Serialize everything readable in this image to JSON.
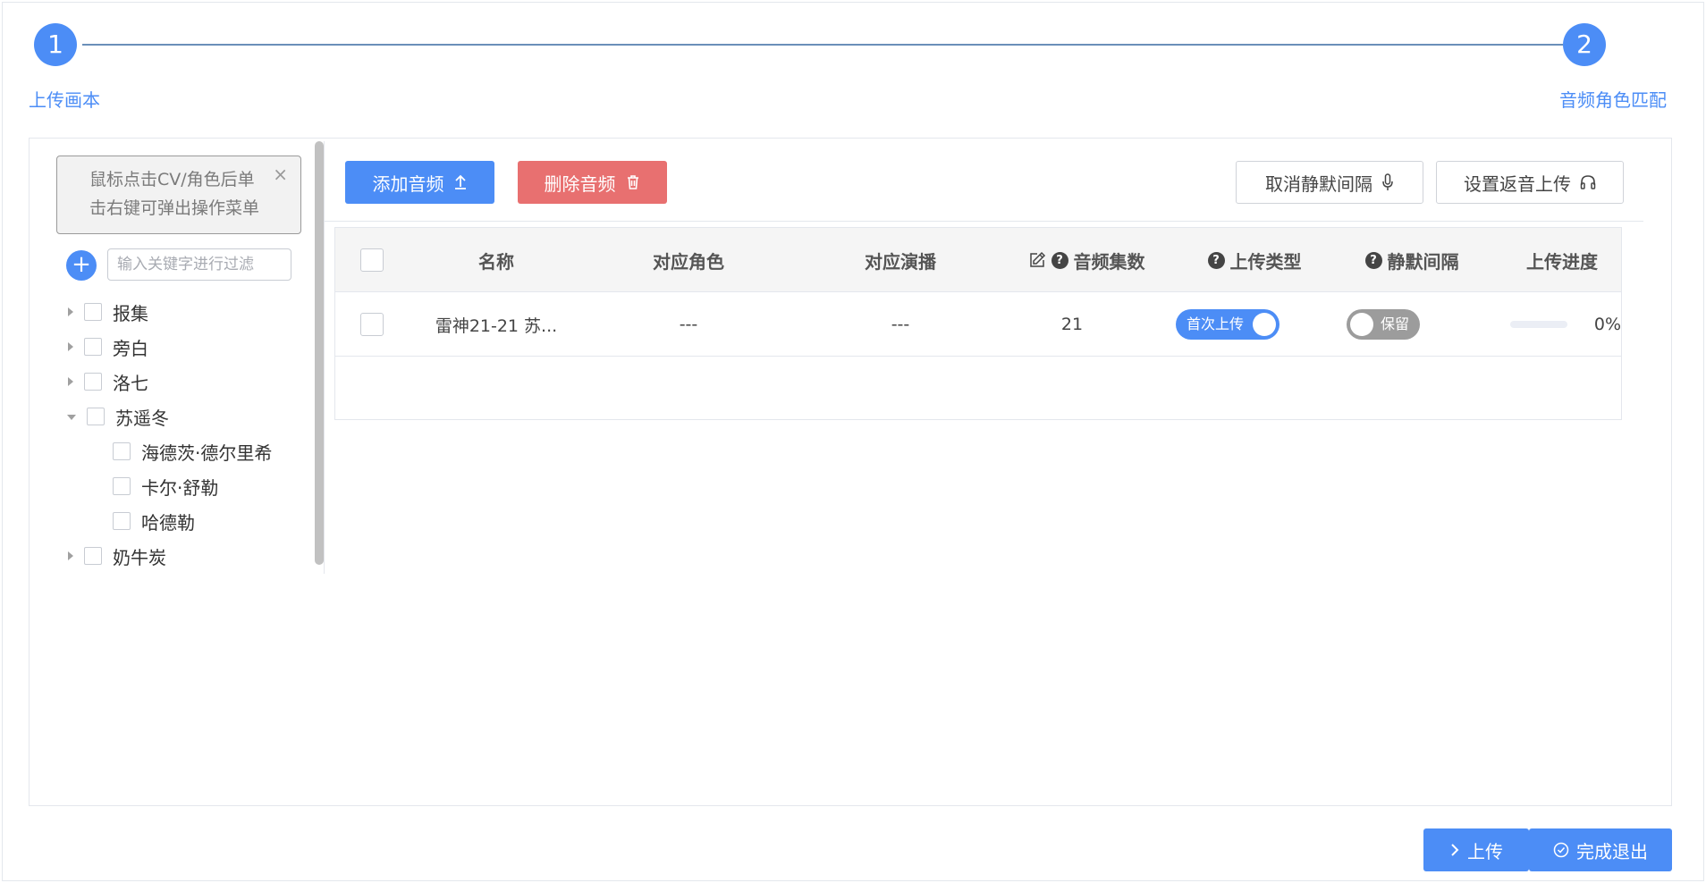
{
  "steps": [
    {
      "number": "1",
      "label": "上传画本"
    },
    {
      "number": "2",
      "label": "音频角色匹配"
    }
  ],
  "tip": {
    "text_line1": "鼠标点击CV/角色后单",
    "text_line2": "击右键可弹出操作菜单",
    "close": "×"
  },
  "filter": {
    "placeholder": "输入关键字进行过滤",
    "value": "",
    "add_symbol": "+"
  },
  "tree": [
    {
      "label": "报集",
      "expanded": false
    },
    {
      "label": "旁白",
      "expanded": false
    },
    {
      "label": "洛七",
      "expanded": false
    },
    {
      "label": "苏遥冬",
      "expanded": true
    },
    {
      "label": "海德茨·德尔里希",
      "child": true
    },
    {
      "label": "卡尔·舒勒",
      "child": true
    },
    {
      "label": "哈德勒",
      "child": true
    },
    {
      "label": "奶牛炭",
      "expanded": false
    }
  ],
  "toolbar": {
    "add_audio": "添加音频",
    "delete_audio": "删除音频",
    "cancel_silence": "取消静默间隔",
    "set_return_upload": "设置返音上传"
  },
  "table": {
    "headers": {
      "name": "名称",
      "role": "对应角色",
      "performer": "对应演播",
      "episodes": "音频集数",
      "upload_type": "上传类型",
      "silence": "静默间隔",
      "progress": "上传进度"
    },
    "rows": [
      {
        "name": "雷神21-21 苏...",
        "role": "---",
        "performer": "---",
        "episodes": "21",
        "upload_type": "首次上传",
        "silence": "保留",
        "progress_value": 0,
        "progress_text": "0%"
      }
    ]
  },
  "footer": {
    "upload": "上传",
    "finish": "完成退出"
  },
  "colors": {
    "primary": "#4c8df6",
    "danger": "#e87070",
    "step_line": "#6a8fb9"
  }
}
